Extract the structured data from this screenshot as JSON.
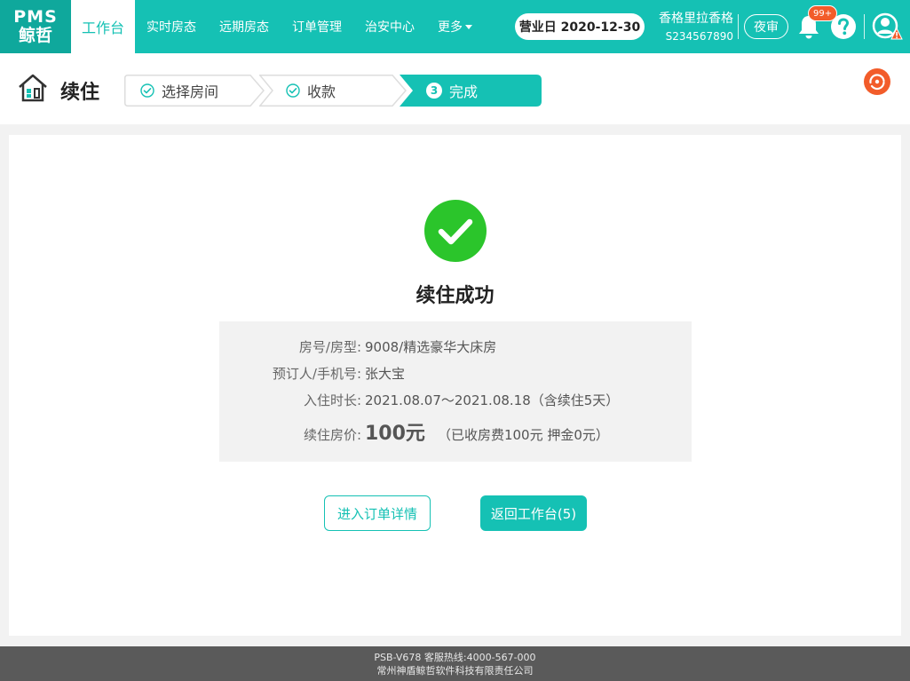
{
  "app": {
    "logo_line1": "PMS",
    "logo_line2": "鲸哲"
  },
  "nav": {
    "items": [
      {
        "label": "工作台"
      },
      {
        "label": "实时房态"
      },
      {
        "label": "远期房态"
      },
      {
        "label": "订单管理"
      },
      {
        "label": "治安中心"
      },
      {
        "label": "更多"
      }
    ]
  },
  "header": {
    "business_day": "营业日 2020-12-30",
    "hotel_name": "香格里拉香格",
    "hotel_code": "S234567890",
    "night_audit_label": "夜审",
    "notification_count": "99+"
  },
  "page": {
    "title": "续住",
    "steps": [
      {
        "label": "选择房间",
        "state": "done"
      },
      {
        "label": "收款",
        "state": "done"
      },
      {
        "label": "完成",
        "state": "current",
        "number": "3"
      }
    ]
  },
  "result": {
    "title": "续住成功",
    "rows": [
      {
        "label": "房号/房型:",
        "value": "9008/精选豪华大床房"
      },
      {
        "label": "预订人/手机号:",
        "value": "张大宝"
      },
      {
        "label": "入住时长:",
        "value": "2021.08.07～2021.08.18（含续住5天）"
      }
    ],
    "price_label": "续住房价:",
    "price_value": "100元",
    "price_note": "（已收房费100元 押金0元）"
  },
  "actions": {
    "order_detail_label": "进入订单详情",
    "back_label": "返回工作台(5)"
  },
  "footer": {
    "line1": "PSB-V678   客服热线:4000-567-000",
    "line2": "常州神盾鲸哲软件科技有限责任公司"
  },
  "colors": {
    "brand": "#15c1b4",
    "success": "#2bc52b",
    "alert": "#f25c2a"
  }
}
